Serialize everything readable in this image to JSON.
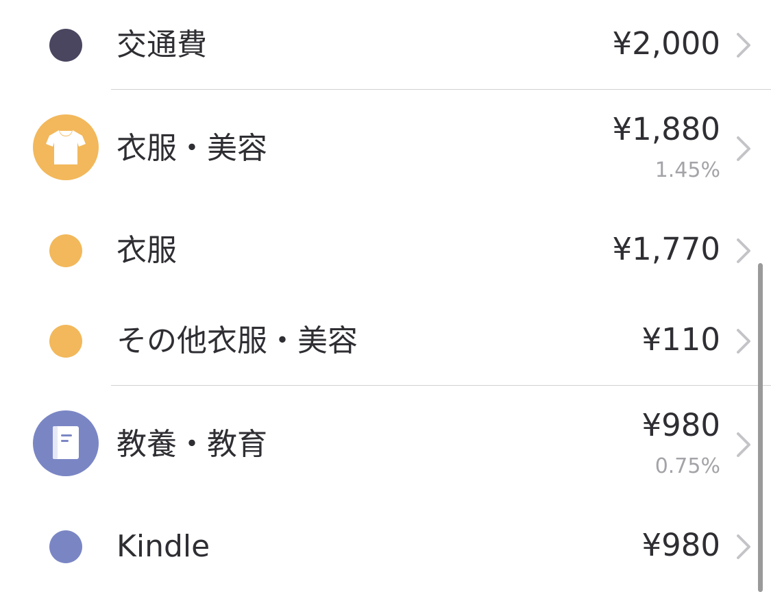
{
  "colors": {
    "dark_navy": "#4a4660",
    "orange": "#f2b85b",
    "periwinkle": "#7a86c4",
    "text": "#2e2e33",
    "secondary_text": "#a3a3a8"
  },
  "rows": [
    {
      "label": "交通費",
      "amount": "¥2,000",
      "icon": "dot",
      "color": "#4a4660"
    },
    {
      "label": "衣服・美容",
      "amount": "¥1,880",
      "percent": "1.45%",
      "icon": "tshirt-icon",
      "color": "#f2b85b"
    },
    {
      "label": "衣服",
      "amount": "¥1,770",
      "icon": "dot",
      "color": "#f2b85b"
    },
    {
      "label": "その他衣服・美容",
      "amount": "¥110",
      "icon": "dot",
      "color": "#f2b85b"
    },
    {
      "label": "教養・教育",
      "amount": "¥980",
      "percent": "0.75%",
      "icon": "book-icon",
      "color": "#7a86c4"
    },
    {
      "label": "Kindle",
      "amount": "¥980",
      "icon": "dot",
      "color": "#7a86c4"
    }
  ]
}
